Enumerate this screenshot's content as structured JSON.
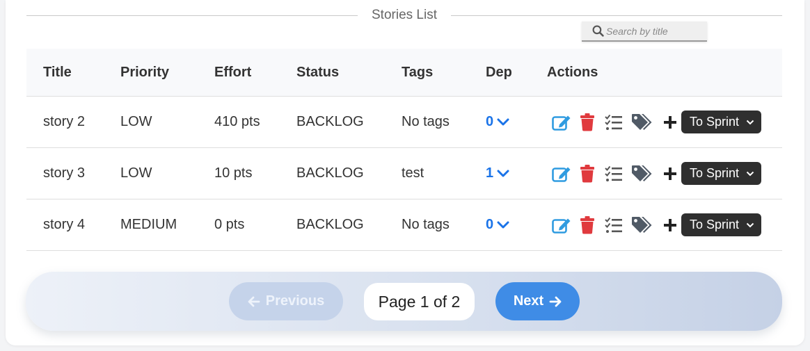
{
  "header": {
    "title": "Stories List",
    "search_placeholder": "Search by title"
  },
  "table": {
    "columns": [
      "Title",
      "Priority",
      "Effort",
      "Status",
      "Tags",
      "Dep",
      "Actions"
    ],
    "rows": [
      {
        "title": "story 2",
        "priority": "LOW",
        "effort": "410 pts",
        "status": "BACKLOG",
        "tags": "No tags",
        "dep": "0",
        "sprint_label": "To Sprint"
      },
      {
        "title": "story 3",
        "priority": "LOW",
        "effort": "10 pts",
        "status": "BACKLOG",
        "tags": "test",
        "dep": "1",
        "sprint_label": "To Sprint"
      },
      {
        "title": "story 4",
        "priority": "MEDIUM",
        "effort": "0 pts",
        "status": "BACKLOG",
        "tags": "No tags",
        "dep": "0",
        "sprint_label": "To Sprint"
      }
    ],
    "action_icons": [
      "edit-icon",
      "trash-icon",
      "task-list-icon",
      "tags-icon",
      "plus-icon"
    ]
  },
  "pagination": {
    "previous_label": "Previous",
    "page_text": "Page 1 of 2",
    "next_label": "Next"
  },
  "colors": {
    "edit": "#2f9be0",
    "delete": "#e03a3e",
    "dep_link": "#1a73e8",
    "sprint_button": "#2f2f2f",
    "next_button": "#3f8ce6",
    "previous_button_disabled": "#c5d3ea"
  }
}
